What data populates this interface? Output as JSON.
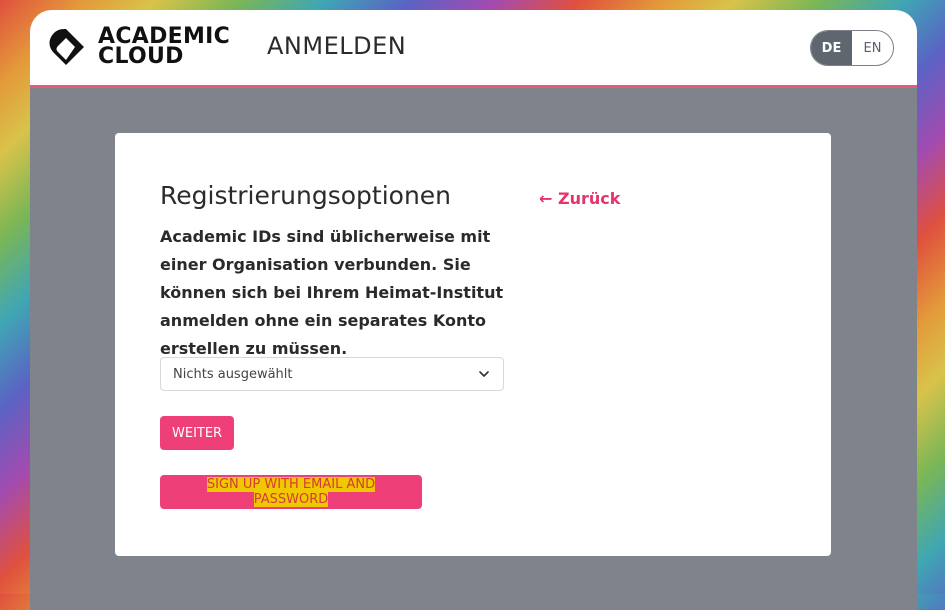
{
  "header": {
    "logo_line1": "ACADEMIC",
    "logo_line2": "CLOUD",
    "title": "ANMELDEN",
    "languages": [
      {
        "label": "DE",
        "active": true
      },
      {
        "label": "EN",
        "active": false
      }
    ]
  },
  "card": {
    "title": "Registrierungsoptionen",
    "back_link": "← Zurück",
    "description": "Academic IDs sind üblicherweise mit einer Organisation verbunden. Sie können sich bei Ihrem Heimat-Institut anmelden ohne ein separates Konto erstellen zu müssen.",
    "select": {
      "value": "Nichts ausgewählt"
    },
    "continue_label": "WEITER",
    "signup_label": "SIGN UP WITH EMAIL AND PASSWORD"
  },
  "colors": {
    "accent": "#ee3f78",
    "header_border": "#e85a7a",
    "backdrop": "#7f838c"
  }
}
